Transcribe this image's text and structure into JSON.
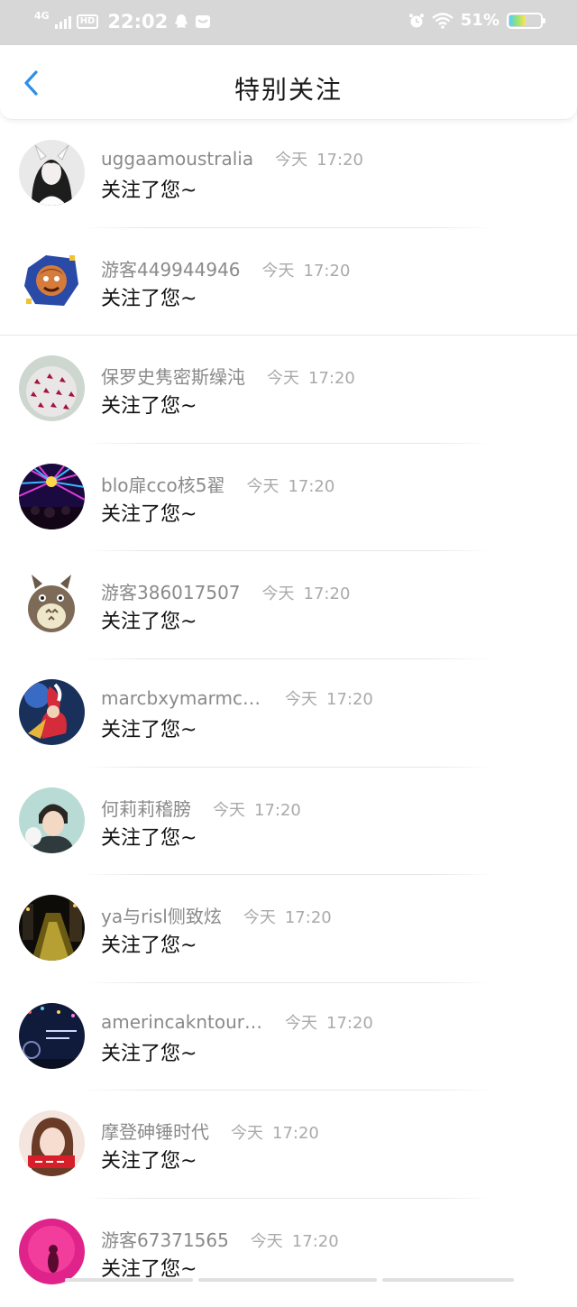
{
  "status_bar": {
    "network": "4G",
    "hd": "HD",
    "time": "22:02",
    "battery_percent": "51%",
    "icons": [
      "signal-icon",
      "hd-icon",
      "qq-icon",
      "mail-icon",
      "alarm-icon",
      "wifi-icon",
      "battery-icon"
    ]
  },
  "nav": {
    "title": "特别关注",
    "back_icon": "chevron-left-icon"
  },
  "colors": {
    "status_bar_bg": "#d7d7d7",
    "back_arrow": "#2f8fe8",
    "username": "#8a8a8a",
    "timestamp": "#aaaaaa",
    "message": "#111111"
  },
  "items": [
    {
      "username": "uggaamoustralia",
      "day": "今天",
      "time": "17:20",
      "message": "关注了您~"
    },
    {
      "username": "游客449944946",
      "day": "今天",
      "time": "17:20",
      "message": "关注了您~"
    },
    {
      "username": "保罗史隽密斯缲沌",
      "day": "今天",
      "time": "17:20",
      "message": "关注了您~"
    },
    {
      "username": "blo扉cco核5翟",
      "day": "今天",
      "time": "17:20",
      "message": "关注了您~"
    },
    {
      "username": "游客386017507",
      "day": "今天",
      "time": "17:20",
      "message": "关注了您~"
    },
    {
      "username": "marcbxymarmcj…",
      "day": "今天",
      "time": "17:20",
      "message": "关注了您~"
    },
    {
      "username": "何莉莉稽膀",
      "day": "今天",
      "time": "17:20",
      "message": "关注了您~"
    },
    {
      "username": "ya与risl侧致炫",
      "day": "今天",
      "time": "17:20",
      "message": "关注了您~"
    },
    {
      "username": "amerincakntouri…",
      "day": "今天",
      "time": "17:20",
      "message": "关注了您~"
    },
    {
      "username": "摩登砷锤时代",
      "day": "今天",
      "time": "17:20",
      "message": "关注了您~"
    },
    {
      "username": "游客67371565",
      "day": "今天",
      "time": "17:20",
      "message": "关注了您~"
    }
  ]
}
